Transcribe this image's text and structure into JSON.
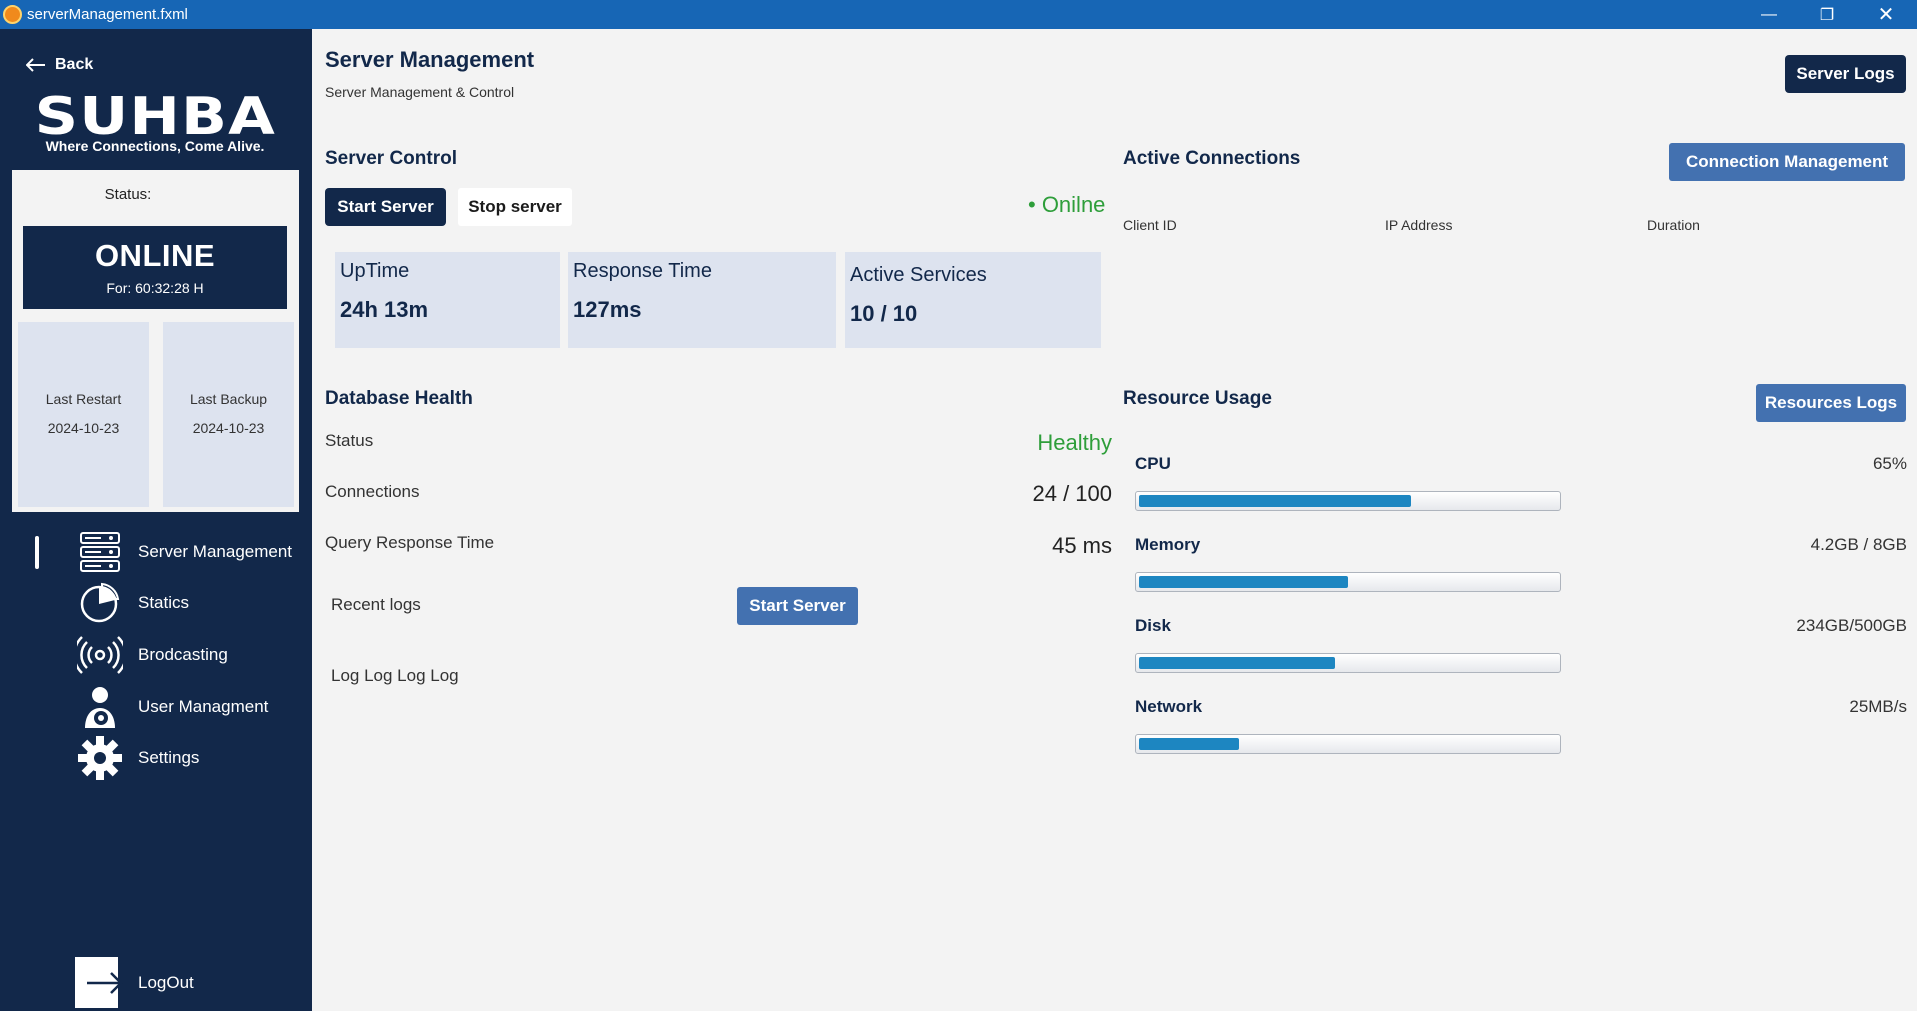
{
  "window": {
    "title": "serverManagement.fxml"
  },
  "sidebar": {
    "back_label": "Back",
    "logo_text": "SUHBA",
    "tagline": "Where Connections, Come Alive.",
    "status_label": "Status:",
    "status_value": "ONLINE",
    "status_duration": "For: 60:32:28 H",
    "last_restart_label": "Last Restart",
    "last_restart_value": "2024-10-23",
    "last_backup_label": "Last Backup",
    "last_backup_value": "2024-10-23",
    "nav": [
      {
        "label": "Server Management",
        "icon": "server-rack-icon",
        "active": true
      },
      {
        "label": "Statics",
        "icon": "pie-chart-icon"
      },
      {
        "label": "Brodcasting",
        "icon": "broadcast-icon"
      },
      {
        "label": "User Managment",
        "icon": "user-gear-icon"
      },
      {
        "label": "Settings",
        "icon": "gear-icon"
      }
    ],
    "logout_label": "LogOut"
  },
  "header": {
    "title": "Server Management",
    "subtitle": "Server Management & Control",
    "server_logs_label": "Server Logs"
  },
  "server_control": {
    "title": "Server Control",
    "start_label": "Start Server",
    "stop_label": "Stop server",
    "status_text": "• Onilne",
    "metrics": [
      {
        "label": "UpTime",
        "value": "24h 13m"
      },
      {
        "label": "Response Time",
        "value": "127ms"
      },
      {
        "label": "Active Services",
        "value": "10 / 10"
      }
    ]
  },
  "active_connections": {
    "title": "Active Connections",
    "button_label": "Connection Management",
    "columns": [
      "Client ID",
      "IP Address",
      "Duration"
    ]
  },
  "database_health": {
    "title": "Database Health",
    "rows": [
      {
        "label": "Status",
        "value": "Healthy"
      },
      {
        "label": "Connections",
        "value": "24 / 100"
      },
      {
        "label": "Query Response Time",
        "value": "45 ms"
      }
    ],
    "recent_logs_label": "Recent logs",
    "recent_logs_button": "Start Server",
    "log_text": "Log Log Log Log"
  },
  "resource_usage": {
    "title": "Resource Usage",
    "button_label": "Resources Logs",
    "items": [
      {
        "name": "CPU",
        "value": "65%",
        "fill": 0.65
      },
      {
        "name": "Memory",
        "value": "4.2GB / 8GB",
        "fill": 0.5
      },
      {
        "name": "Disk",
        "value": "234GB/500GB",
        "fill": 0.468
      },
      {
        "name": "Network",
        "value": "25MB/s",
        "fill": 0.24
      }
    ]
  },
  "colors": {
    "sidebar_bg": "#12284a",
    "accent_blue": "#4371b0",
    "status_green": "#2e9e3a",
    "bar_fill": "#1d86c1"
  }
}
